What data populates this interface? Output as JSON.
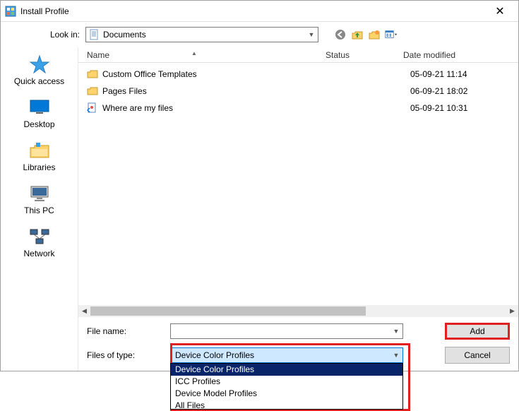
{
  "title": "Install Profile",
  "look_in_label": "Look in:",
  "look_in_value": "Documents",
  "columns": {
    "name": "Name",
    "status": "Status",
    "date": "Date modified"
  },
  "files": [
    {
      "name": "Custom Office Templates",
      "status": "",
      "date": "05-09-21 11:14",
      "kind": "folder"
    },
    {
      "name": "Pages Files",
      "status": "",
      "date": "06-09-21 18:02",
      "kind": "folder"
    },
    {
      "name": "Where are my files",
      "status": "",
      "date": "05-09-21 10:31",
      "kind": "shortcut"
    }
  ],
  "places": [
    {
      "label": "Quick access",
      "icon": "star"
    },
    {
      "label": "Desktop",
      "icon": "desktop"
    },
    {
      "label": "Libraries",
      "icon": "libraries"
    },
    {
      "label": "This PC",
      "icon": "pc"
    },
    {
      "label": "Network",
      "icon": "network"
    }
  ],
  "file_name_label": "File name:",
  "file_name_value": "",
  "file_type_label": "Files of type:",
  "file_type_value": "Device Color Profiles",
  "file_type_options": [
    "Device Color Profiles",
    "ICC Profiles",
    "Device Model Profiles",
    "All Files"
  ],
  "add_label": "Add",
  "cancel_label": "Cancel",
  "toolbar_icons": [
    "back",
    "up",
    "new-folder",
    "view-menu"
  ]
}
